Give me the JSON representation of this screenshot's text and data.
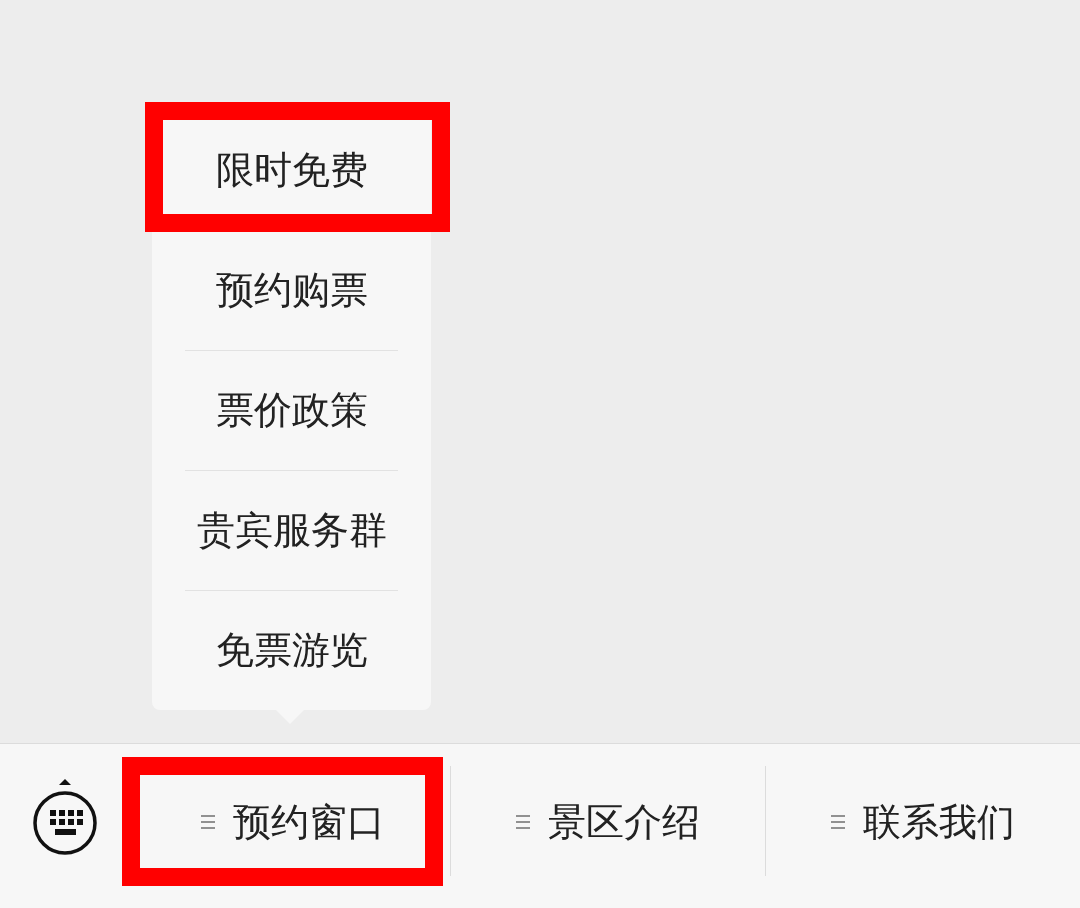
{
  "submenu": {
    "items": [
      {
        "label": "限时免费",
        "highlighted": true
      },
      {
        "label": "预约购票",
        "highlighted": false
      },
      {
        "label": "票价政策",
        "highlighted": false
      },
      {
        "label": "贵宾服务群",
        "highlighted": false
      },
      {
        "label": "免票游览",
        "highlighted": false
      }
    ]
  },
  "menu_bar": {
    "tabs": [
      {
        "label": "预约窗口",
        "open": true,
        "highlighted": true
      },
      {
        "label": "景区介绍",
        "open": false,
        "highlighted": false
      },
      {
        "label": "联系我们",
        "open": false,
        "highlighted": false
      }
    ]
  }
}
